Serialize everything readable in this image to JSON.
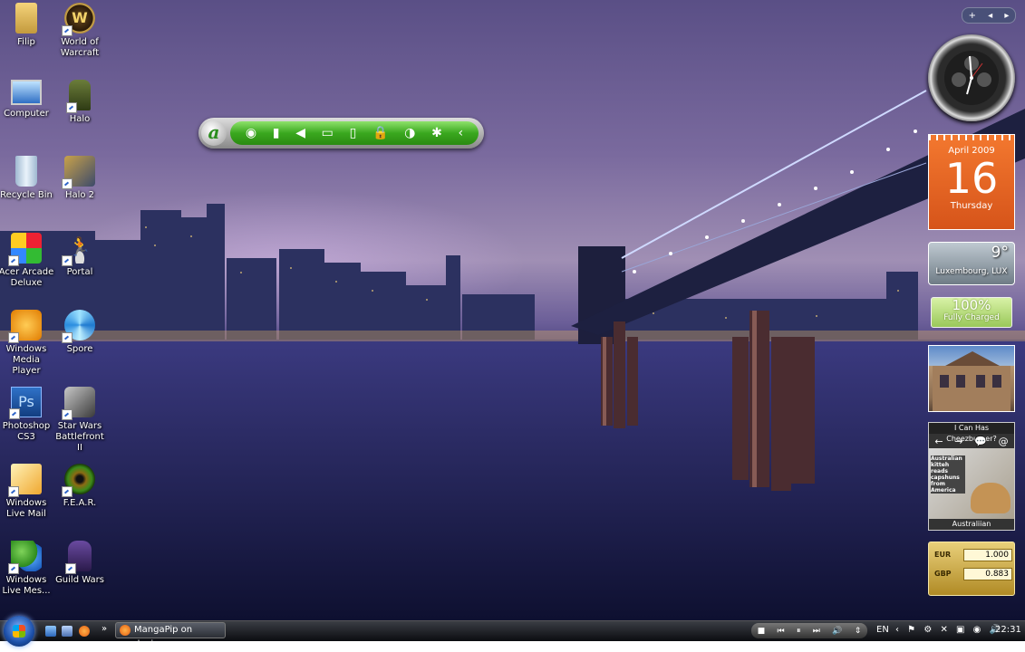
{
  "desktop": {
    "icons_left": [
      {
        "label": "Filip",
        "icon": "user-folder-icon"
      },
      {
        "label": "Computer",
        "icon": "computer-icon"
      },
      {
        "label": "Recycle Bin",
        "icon": "recycle-bin-icon"
      },
      {
        "label": "Acer Arcade Deluxe",
        "icon": "acer-arcade-icon"
      },
      {
        "label": "Windows Media Player",
        "icon": "media-player-icon"
      },
      {
        "label": "Photoshop CS3",
        "icon": "photoshop-icon"
      },
      {
        "label": "Windows Live Mail",
        "icon": "live-mail-icon"
      },
      {
        "label": "Windows Live Mes...",
        "icon": "live-messenger-icon"
      }
    ],
    "icons_right": [
      {
        "label": "World of Warcraft",
        "icon": "wow-icon"
      },
      {
        "label": "Halo",
        "icon": "halo-icon"
      },
      {
        "label": "Halo 2",
        "icon": "halo2-icon"
      },
      {
        "label": "Portal",
        "icon": "portal-icon"
      },
      {
        "label": "Spore",
        "icon": "spore-icon"
      },
      {
        "label": "Star Wars Battlefront II",
        "icon": "battlefront-icon"
      },
      {
        "label": "F.E.A.R.",
        "icon": "fear-icon"
      },
      {
        "label": "Guild Wars",
        "icon": "guild-wars-icon"
      }
    ]
  },
  "acer_toolbar": {
    "logo": "a",
    "buttons": [
      {
        "name": "wireless-icon",
        "glyph": "◉"
      },
      {
        "name": "battery-icon",
        "glyph": "▮"
      },
      {
        "name": "volume-icon",
        "glyph": "◀"
      },
      {
        "name": "display-icon",
        "glyph": "▭"
      },
      {
        "name": "power-plan-icon",
        "glyph": "▯"
      },
      {
        "name": "lock-icon",
        "glyph": "🔒"
      },
      {
        "name": "backup-icon",
        "glyph": "◑"
      },
      {
        "name": "settings-icon",
        "glyph": "✱"
      },
      {
        "name": "collapse-icon",
        "glyph": "‹"
      }
    ]
  },
  "sidebar": {
    "controls": {
      "add": "+",
      "prev": "◂",
      "next": "▸"
    },
    "calendar": {
      "month": "April 2009",
      "day": "16",
      "weekday": "Thursday"
    },
    "weather": {
      "temp": "9°",
      "location": "Luxembourg, LUX"
    },
    "battery": {
      "percent": "100%",
      "status": "Fully Charged"
    },
    "cheezburger": {
      "title": "I Can Has Cheezburger?",
      "nav": [
        "←",
        "→",
        "💬",
        "@"
      ],
      "caption": "Australian kitteh reads capshuns from America",
      "label": "Australiian"
    },
    "currency": [
      {
        "code": "EUR",
        "value": "1.000"
      },
      {
        "code": "GBP",
        "value": "0.883"
      }
    ]
  },
  "taskbar": {
    "window_button": "MangaPip on devia...",
    "chevron": "»",
    "media_controls": [
      "■",
      "⏮",
      "⏸",
      "⏭",
      "🔊",
      "⇕"
    ],
    "language": "EN",
    "tray": "‹ ⚑ ⚙ ✕ ▣ ◉ 🔊",
    "time": "22:31"
  }
}
